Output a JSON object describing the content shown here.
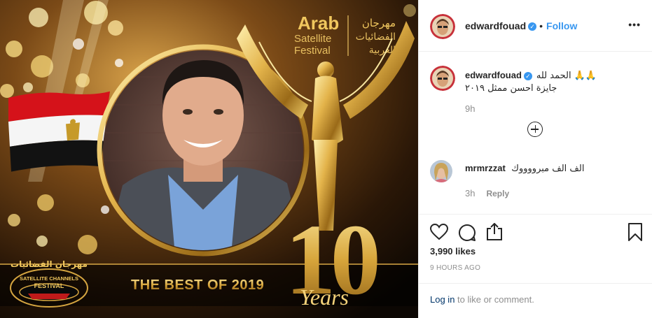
{
  "image": {
    "festival": {
      "en_line1": "Arab",
      "en_line2": "Satellite",
      "en_line3": "Festival",
      "ar_line1": "مهرجان",
      "ar_line2": "الفضائيات",
      "ar_line3": "العربية"
    },
    "badge": {
      "ar": "مهرجان الفضائيات",
      "en1": "SATELLITE CHANNELS",
      "en2": "FESTIVAL"
    },
    "banner_text": "THE BEST OF 2019",
    "anniversary_number": "10",
    "anniversary_word": "Years"
  },
  "post": {
    "author": {
      "username": "edwardfouad",
      "verified": true,
      "follow_label": "Follow",
      "more_label": "•••"
    },
    "caption": {
      "username": "edwardfouad",
      "line1": "الحمد لله 🙏🙏",
      "line2": "جايزة احسن ممثل ٢٠١٩",
      "time": "9h"
    },
    "comments": [
      {
        "username": "mrmrzzat",
        "text": "الف الف مبرووووك",
        "time": "3h",
        "reply_label": "Reply"
      }
    ],
    "likes": "3,990 likes",
    "posted_ago": "9 HOURS AGO",
    "login_prompt": {
      "link": "Log in",
      "rest": " to like or comment."
    }
  },
  "colors": {
    "link_blue": "#3897f0",
    "gold": "#d4a640",
    "text": "#262626",
    "muted": "#8e8e8e"
  }
}
